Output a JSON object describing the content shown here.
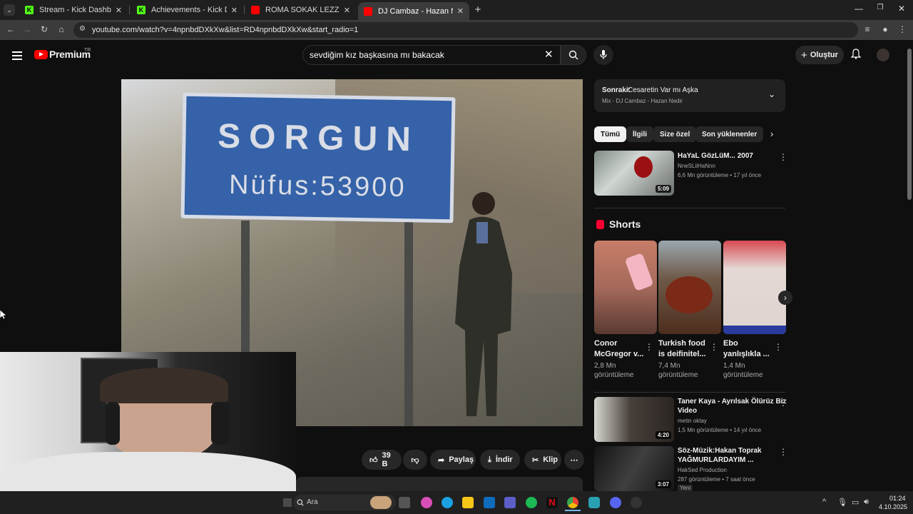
{
  "browser": {
    "tabs": [
      {
        "title": "Stream - Kick Dashboard",
        "active": false
      },
      {
        "title": "Achievements - Kick Dashboard",
        "active": false
      },
      {
        "title": "ROMA SOKAK LEZZETLERİ! İTALYA",
        "active": false
      },
      {
        "title": "DJ Cambaz - Hazan Nedir - YouTube",
        "active": true
      }
    ],
    "url": "youtube.com/watch?v=4npnbdDXkXw&list=RD4npnbdDXkXw&start_radio=1"
  },
  "youtube": {
    "logo_text": "Premium",
    "logo_country": "TR",
    "search_value": "sevdiğim kız başkasına mı bakacak",
    "create_label": "Oluştur",
    "video_sign": {
      "line1": "SORGUN",
      "line2": "Nüfus:53900"
    },
    "actions": {
      "likes": "39 B",
      "share": "Paylaş",
      "download": "İndir",
      "clip": "Klip"
    },
    "up_next": {
      "label": "Sonraki:",
      "title": "Cesaretin Var mı Aşka",
      "subtitle": "Mix - DJ Cambaz - Hazan Nedir"
    },
    "chips": [
      "Tümü",
      "İlgili",
      "Size özel",
      "Son yüklenenler"
    ],
    "videos": [
      {
        "title": "HaYaL GözLüM... 2007",
        "channel": "NneSLiiHaNnn",
        "meta": "6,6 Mn görüntüleme • 17 yıl önce",
        "duration": "5:09"
      },
      {
        "title_l1": "Taner Kaya - Ayrılsak Ölürüz Biz",
        "title_l2": "Video",
        "channel": "metin oktay",
        "meta": "1,5 Mn görüntüleme • 14 yıl önce",
        "duration": "4:20"
      },
      {
        "title_l1": "Söz-Müzik:Hakan Toprak",
        "title_l2": "YAĞMURLARDAYIM ...",
        "channel": "HakSed Production",
        "meta": "287 görüntüleme • 7 saat önce",
        "duration": "3:07",
        "badge": "Yeni"
      }
    ],
    "shorts_label": "Shorts",
    "shorts": [
      {
        "title_l1": "Conor",
        "title_l2": "McGregor v...",
        "views_l1": "2,8 Mn",
        "views_l2": "görüntüleme"
      },
      {
        "title_l1": "Turkish food",
        "title_l2": "is deifinitel...",
        "views_l1": "7,4 Mn",
        "views_l2": "görüntüleme"
      },
      {
        "title_l1": "Ebo",
        "title_l2": "yanlışlıkla ...",
        "views_l1": "1,4 Mn",
        "views_l2": "görüntüleme"
      }
    ]
  },
  "taskbar": {
    "search_placeholder": "Ara",
    "time": "01:24",
    "date": "4.10.2025"
  },
  "colors": {
    "yt_red": "#ff0000",
    "kick_green": "#53fc18",
    "bg": "#0f0f0f"
  }
}
